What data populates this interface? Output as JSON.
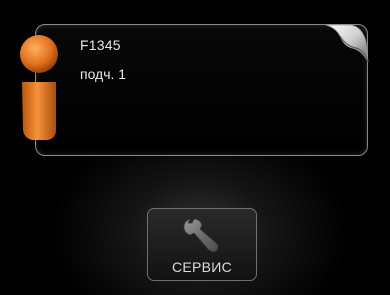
{
  "info": {
    "model": "F1345",
    "sub": "подч. 1",
    "icon": "info-icon",
    "accent_color": "#e07a2a"
  },
  "service": {
    "label": "СЕРВИС",
    "icon": "wrench-icon"
  }
}
